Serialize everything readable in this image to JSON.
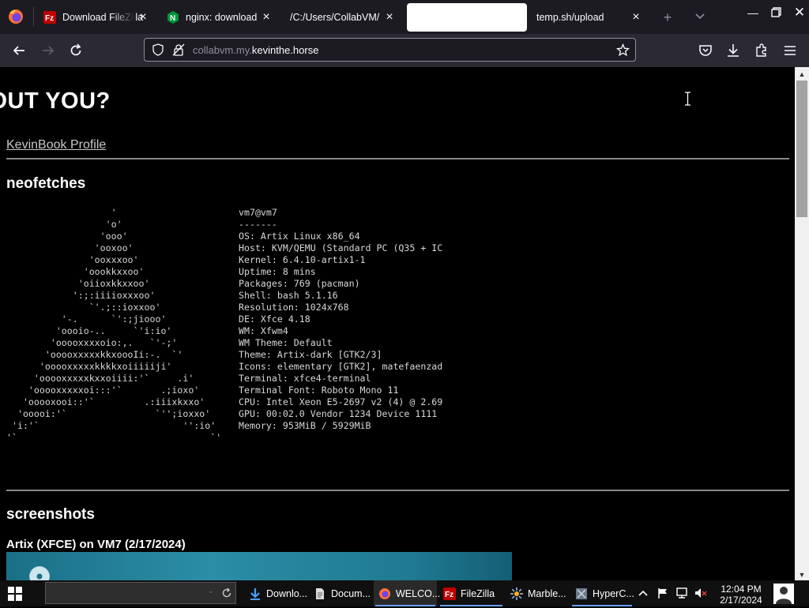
{
  "browser": {
    "tabs": [
      {
        "label": "Download FileZilla",
        "favicon": "filezilla-icon",
        "active": false
      },
      {
        "label": "nginx: download",
        "favicon": "nginx-icon",
        "active": false
      },
      {
        "label": "/C:/Users/CollabVM/D",
        "favicon": "none",
        "active": false
      },
      {
        "label": "",
        "favicon": "none",
        "active": true
      },
      {
        "label": "temp.sh/upload",
        "favicon": "none",
        "active": false
      }
    ],
    "url_prefix": "collabvm.my.",
    "url_domain": "kevinthe.horse"
  },
  "page": {
    "heading": "BOUT YOU?",
    "profile_link": "KevinBook Profile",
    "neofetch_heading": "neofetches",
    "neofetch_art": "                   '\n                  'o'\n                 'ooo'\n                'ooxoo'\n               'ooxxxoo'\n              'oookkxxoo'\n             'oiioxkkxxoo'\n            ':;:iiiioxxxoo'\n               `'.;::ioxxoo'\n          '-.      `':;jiooo'\n         'oooio-..     `'i:io'\n        'ooooxxxxoio:,.   `'-;'\n       'ooooxxxxxkkxoooIi:-.  `'\n      'ooooxxxxxkkkkxoiiiiiji'\n     'ooooxxxxxkxxoiiii:'`     .i'\n    'ooooxxxxxoi:::'`       .;ioxo'\n   'ooooxooi::'`         .:iiixkxxo'\n  'ooooi:'`                `'';ioxxo'\n 'i:'`                          '':io'\n'`                                   `'",
    "neofetch_info": "vm7@vm7\n-------\nOS: Artix Linux x86_64\nHost: KVM/QEMU (Standard PC (Q35 + IC\nKernel: 6.4.10-artix1-1\nUptime: 8 mins\nPackages: 769 (pacman)\nShell: bash 5.1.16\nResolution: 1024x768\nDE: Xfce 4.18\nWM: Xfwm4\nWM Theme: Default\nTheme: Artix-dark [GTK2/3]\nIcons: elementary [GTK2], matefaenzad\nTerminal: xfce4-terminal\nTerminal Font: Roboto Mono 11\nCPU: Intel Xeon E5-2697 v2 (4) @ 2.69\nGPU: 00:02.0 Vendor 1234 Device 1111\nMemory: 953MiB / 5929MiB",
    "screenshots_heading": "screenshots",
    "screenshot_caption": "Artix (XFCE) on VM7 (2/17/2024)"
  },
  "taskbar": {
    "tasks": [
      {
        "label": "Downlo...",
        "icon": "download-arrow-icon"
      },
      {
        "label": "Docum...",
        "icon": "document-icon"
      },
      {
        "label": "WELCO...",
        "icon": "firefox-icon"
      },
      {
        "label": "FileZilla",
        "icon": "filezilla-icon"
      },
      {
        "label": "Marble...",
        "icon": "marble-icon"
      },
      {
        "label": "HyperC...",
        "icon": "hyperc-icon"
      }
    ],
    "time": "12:04 PM",
    "date": "2/17/2024"
  },
  "colors": {
    "tab_strip": "#1c1b22",
    "nav_bar": "#2b2a33",
    "page_bg": "#000000",
    "taskbar": "#101010",
    "accent": "#6aa0ff"
  }
}
